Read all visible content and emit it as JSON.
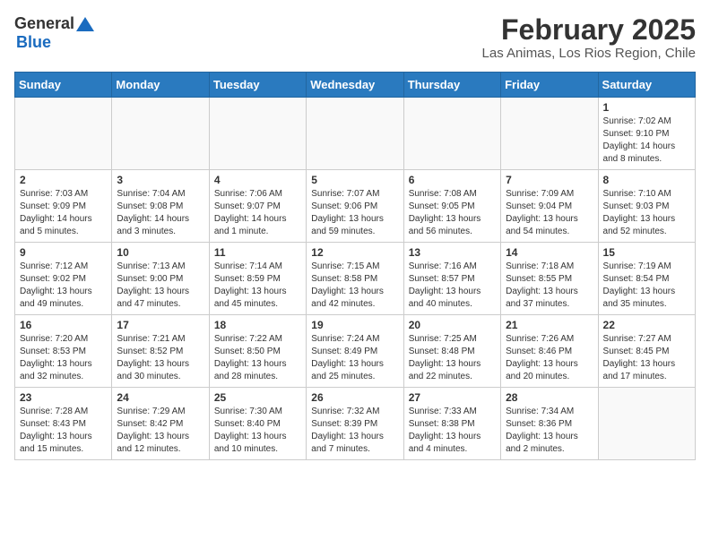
{
  "header": {
    "logo_general": "General",
    "logo_blue": "Blue",
    "month_title": "February 2025",
    "location": "Las Animas, Los Rios Region, Chile"
  },
  "weekdays": [
    "Sunday",
    "Monday",
    "Tuesday",
    "Wednesday",
    "Thursday",
    "Friday",
    "Saturday"
  ],
  "days": [
    {
      "date": "",
      "info": ""
    },
    {
      "date": "",
      "info": ""
    },
    {
      "date": "",
      "info": ""
    },
    {
      "date": "",
      "info": ""
    },
    {
      "date": "",
      "info": ""
    },
    {
      "date": "",
      "info": ""
    },
    {
      "date": "1",
      "info": "Sunrise: 7:02 AM\nSunset: 9:10 PM\nDaylight: 14 hours\nand 8 minutes."
    },
    {
      "date": "2",
      "info": "Sunrise: 7:03 AM\nSunset: 9:09 PM\nDaylight: 14 hours\nand 5 minutes."
    },
    {
      "date": "3",
      "info": "Sunrise: 7:04 AM\nSunset: 9:08 PM\nDaylight: 14 hours\nand 3 minutes."
    },
    {
      "date": "4",
      "info": "Sunrise: 7:06 AM\nSunset: 9:07 PM\nDaylight: 14 hours\nand 1 minute."
    },
    {
      "date": "5",
      "info": "Sunrise: 7:07 AM\nSunset: 9:06 PM\nDaylight: 13 hours\nand 59 minutes."
    },
    {
      "date": "6",
      "info": "Sunrise: 7:08 AM\nSunset: 9:05 PM\nDaylight: 13 hours\nand 56 minutes."
    },
    {
      "date": "7",
      "info": "Sunrise: 7:09 AM\nSunset: 9:04 PM\nDaylight: 13 hours\nand 54 minutes."
    },
    {
      "date": "8",
      "info": "Sunrise: 7:10 AM\nSunset: 9:03 PM\nDaylight: 13 hours\nand 52 minutes."
    },
    {
      "date": "9",
      "info": "Sunrise: 7:12 AM\nSunset: 9:02 PM\nDaylight: 13 hours\nand 49 minutes."
    },
    {
      "date": "10",
      "info": "Sunrise: 7:13 AM\nSunset: 9:00 PM\nDaylight: 13 hours\nand 47 minutes."
    },
    {
      "date": "11",
      "info": "Sunrise: 7:14 AM\nSunset: 8:59 PM\nDaylight: 13 hours\nand 45 minutes."
    },
    {
      "date": "12",
      "info": "Sunrise: 7:15 AM\nSunset: 8:58 PM\nDaylight: 13 hours\nand 42 minutes."
    },
    {
      "date": "13",
      "info": "Sunrise: 7:16 AM\nSunset: 8:57 PM\nDaylight: 13 hours\nand 40 minutes."
    },
    {
      "date": "14",
      "info": "Sunrise: 7:18 AM\nSunset: 8:55 PM\nDaylight: 13 hours\nand 37 minutes."
    },
    {
      "date": "15",
      "info": "Sunrise: 7:19 AM\nSunset: 8:54 PM\nDaylight: 13 hours\nand 35 minutes."
    },
    {
      "date": "16",
      "info": "Sunrise: 7:20 AM\nSunset: 8:53 PM\nDaylight: 13 hours\nand 32 minutes."
    },
    {
      "date": "17",
      "info": "Sunrise: 7:21 AM\nSunset: 8:52 PM\nDaylight: 13 hours\nand 30 minutes."
    },
    {
      "date": "18",
      "info": "Sunrise: 7:22 AM\nSunset: 8:50 PM\nDaylight: 13 hours\nand 28 minutes."
    },
    {
      "date": "19",
      "info": "Sunrise: 7:24 AM\nSunset: 8:49 PM\nDaylight: 13 hours\nand 25 minutes."
    },
    {
      "date": "20",
      "info": "Sunrise: 7:25 AM\nSunset: 8:48 PM\nDaylight: 13 hours\nand 22 minutes."
    },
    {
      "date": "21",
      "info": "Sunrise: 7:26 AM\nSunset: 8:46 PM\nDaylight: 13 hours\nand 20 minutes."
    },
    {
      "date": "22",
      "info": "Sunrise: 7:27 AM\nSunset: 8:45 PM\nDaylight: 13 hours\nand 17 minutes."
    },
    {
      "date": "23",
      "info": "Sunrise: 7:28 AM\nSunset: 8:43 PM\nDaylight: 13 hours\nand 15 minutes."
    },
    {
      "date": "24",
      "info": "Sunrise: 7:29 AM\nSunset: 8:42 PM\nDaylight: 13 hours\nand 12 minutes."
    },
    {
      "date": "25",
      "info": "Sunrise: 7:30 AM\nSunset: 8:40 PM\nDaylight: 13 hours\nand 10 minutes."
    },
    {
      "date": "26",
      "info": "Sunrise: 7:32 AM\nSunset: 8:39 PM\nDaylight: 13 hours\nand 7 minutes."
    },
    {
      "date": "27",
      "info": "Sunrise: 7:33 AM\nSunset: 8:38 PM\nDaylight: 13 hours\nand 4 minutes."
    },
    {
      "date": "28",
      "info": "Sunrise: 7:34 AM\nSunset: 8:36 PM\nDaylight: 13 hours\nand 2 minutes."
    },
    {
      "date": "",
      "info": ""
    }
  ]
}
